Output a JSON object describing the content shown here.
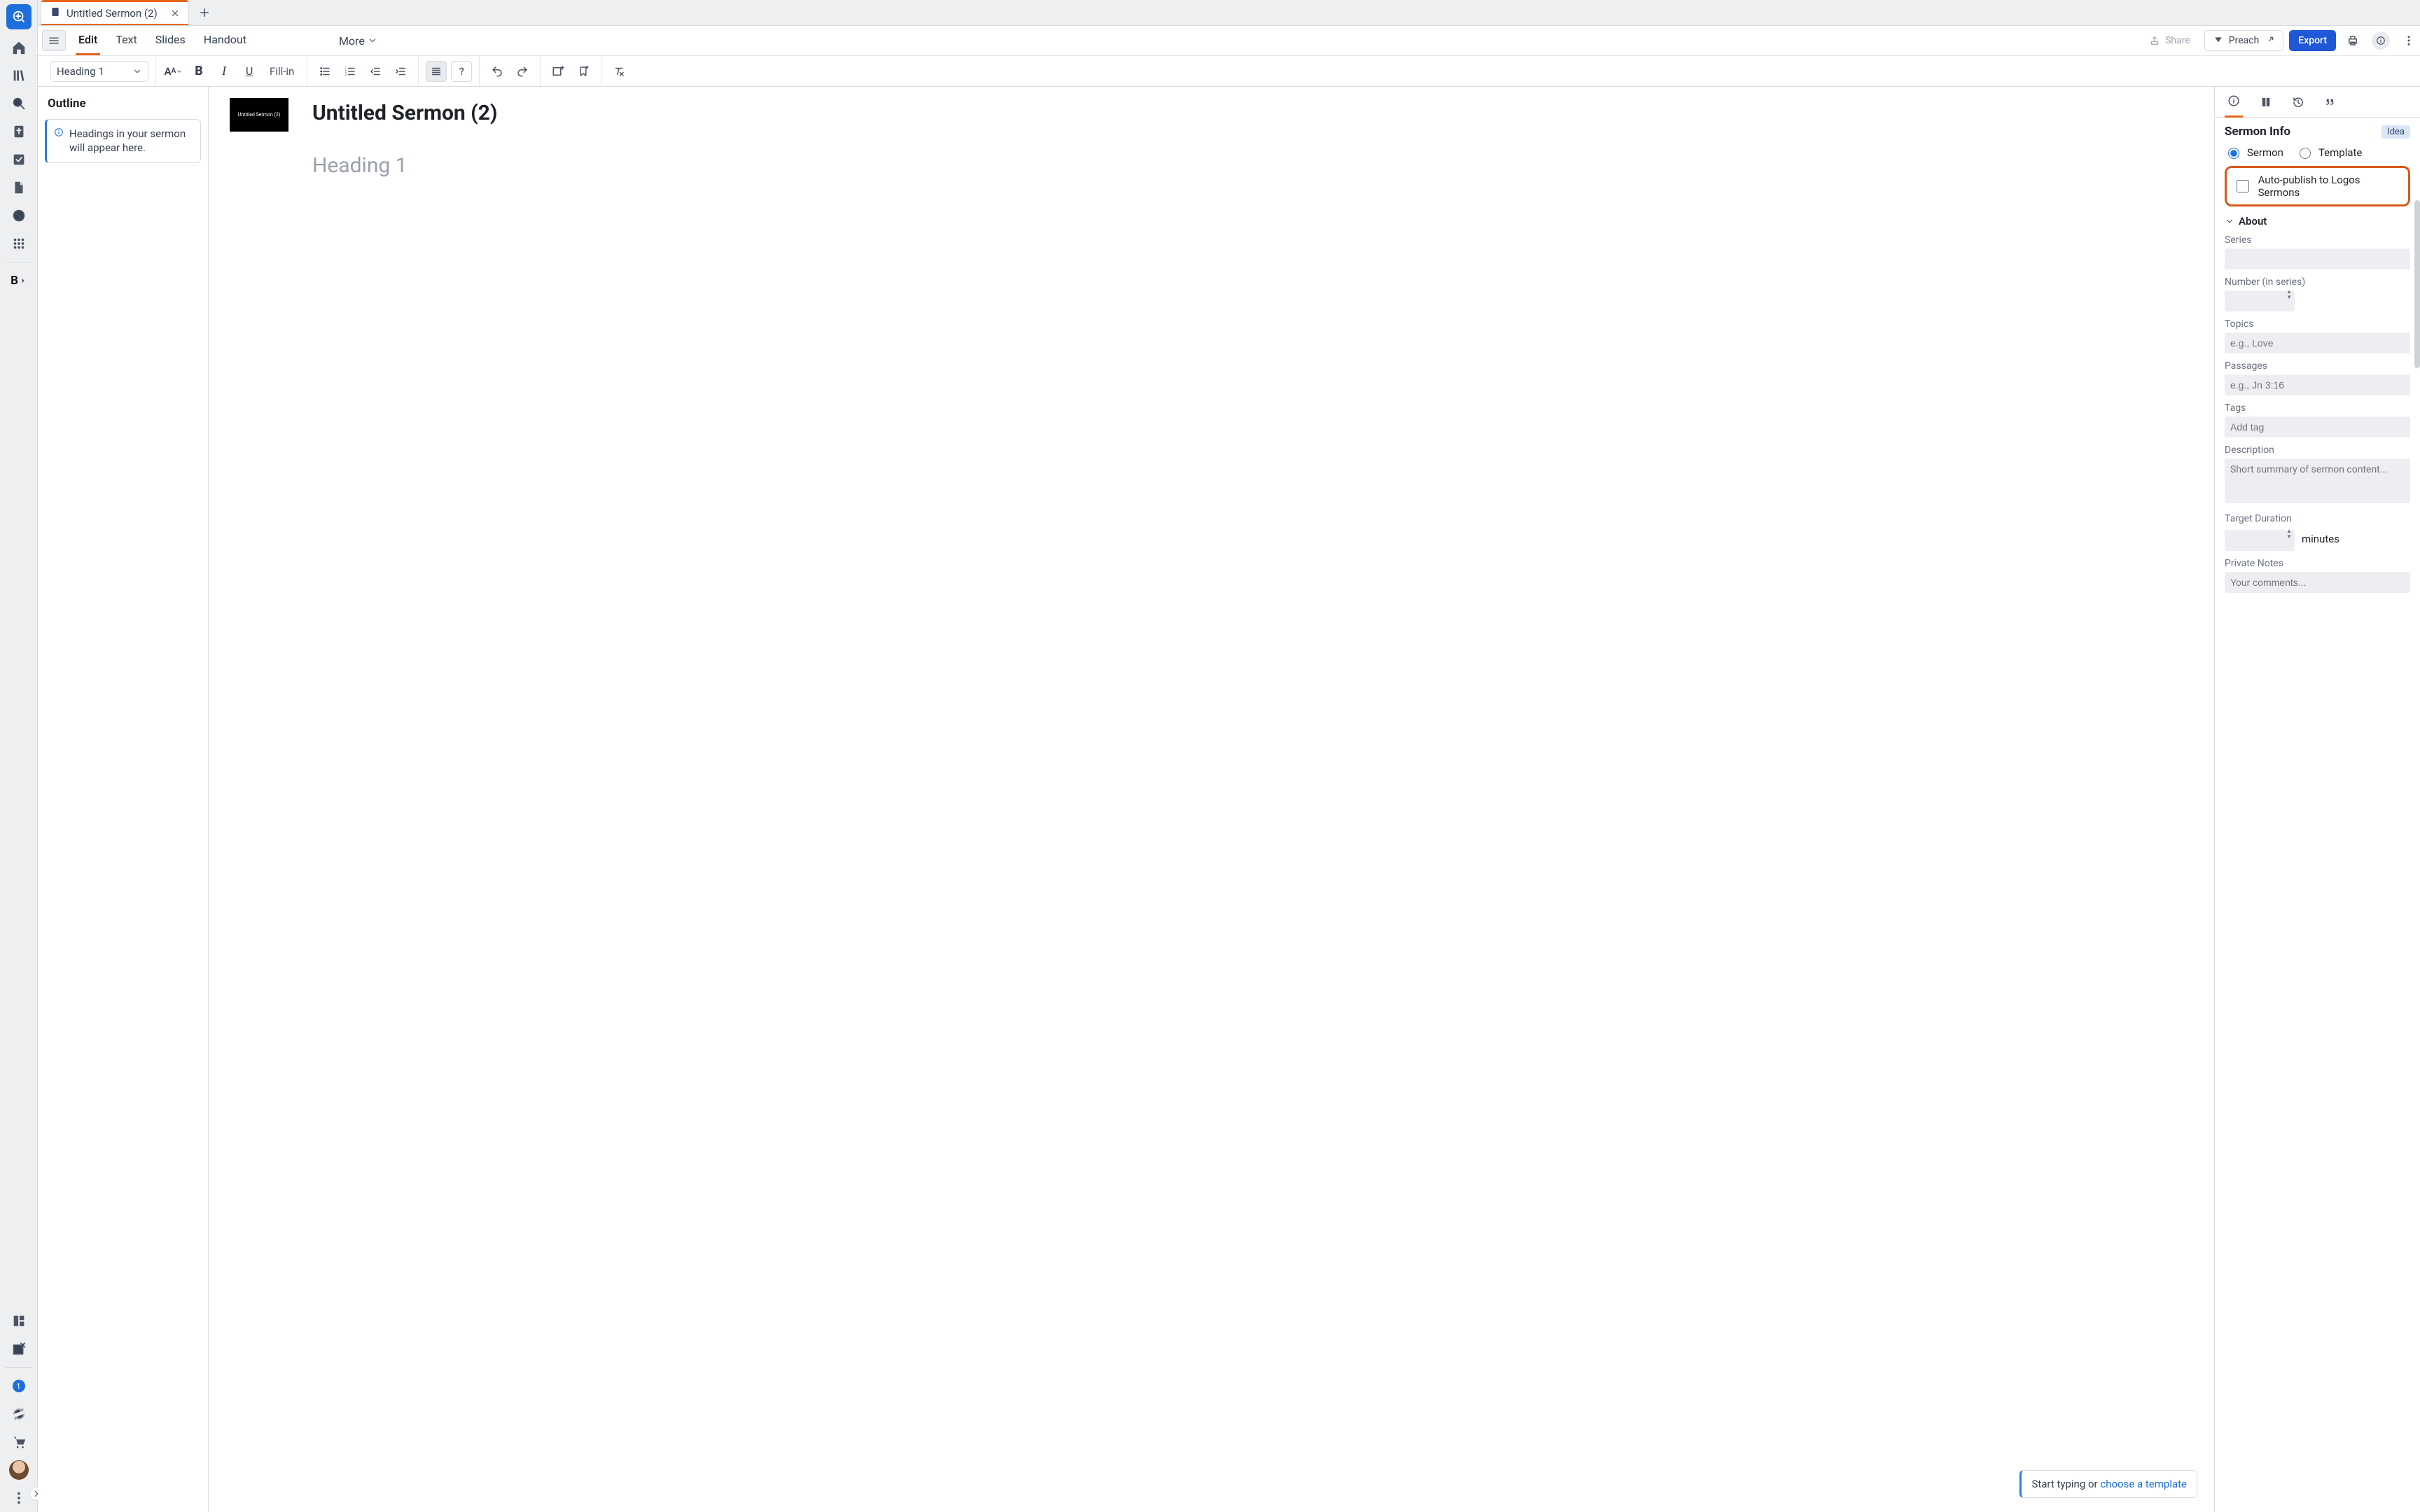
{
  "tab": {
    "title": "Untitled Sermon (2)"
  },
  "views": {
    "edit": "Edit",
    "text": "Text",
    "slides": "Slides",
    "handout": "Handout",
    "more": "More"
  },
  "actions": {
    "share": "Share",
    "preach": "Preach",
    "export": "Export"
  },
  "format": {
    "style": "Heading 1",
    "fillin": "Fill-in"
  },
  "outline": {
    "title": "Outline",
    "hint": "Headings in your sermon will appear here."
  },
  "editor": {
    "thumb_label": "Untitled Sermon (2)",
    "doc_title": "Untitled Sermon (2)",
    "heading_placeholder": "Heading 1",
    "template_pre": "Start typing or ",
    "template_link": "choose a template"
  },
  "info": {
    "title": "Sermon Info",
    "idea": "Idea",
    "type_sermon": "Sermon",
    "type_template": "Template",
    "autopublish": "Auto-publish to Logos Sermons",
    "about": "About",
    "series": "Series",
    "number": "Number (in series)",
    "topics": "Topics",
    "topics_ph": "e.g., Love",
    "passages": "Passages",
    "passages_ph": "e.g., Jn 3:16",
    "tags": "Tags",
    "tags_ph": "Add tag",
    "description": "Description",
    "description_ph": "Short summary of sermon content...",
    "duration": "Target Duration",
    "minutes": "minutes",
    "notes": "Private Notes",
    "notes_ph": "Your comments..."
  },
  "rail": {
    "badge": "1",
    "bold": "B"
  }
}
